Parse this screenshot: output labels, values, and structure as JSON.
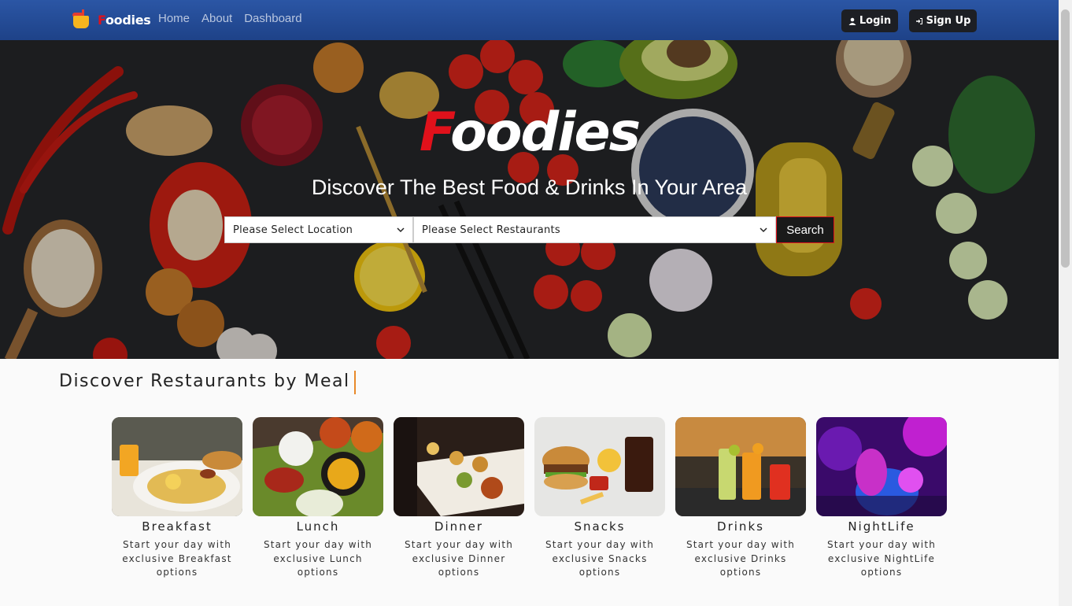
{
  "navbar": {
    "brand_first": "F",
    "brand_rest": "oodies",
    "links": [
      "Home",
      "About",
      "Dashboard"
    ],
    "login_label": "Login",
    "signup_label": "Sign Up"
  },
  "hero": {
    "title_first": "F",
    "title_rest": "oodies",
    "subtitle": "Discover The Best Food & Drinks In Your Area",
    "location_placeholder": "Please Select Location",
    "restaurant_placeholder": "Please Select Restaurants",
    "search_label": "Search"
  },
  "meals_section": {
    "title": "Discover Restaurants by Meal",
    "cards": [
      {
        "name": "Breakfast",
        "desc_line1": "Start your day with",
        "desc_line2": "exclusive Breakfast",
        "desc_line3": "options"
      },
      {
        "name": "Lunch",
        "desc_line1": "Start your day with",
        "desc_line2": "exclusive Lunch",
        "desc_line3": "options"
      },
      {
        "name": "Dinner",
        "desc_line1": "Start your day with",
        "desc_line2": "exclusive Dinner",
        "desc_line3": "options"
      },
      {
        "name": "Snacks",
        "desc_line1": "Start your day with",
        "desc_line2": "exclusive Snacks",
        "desc_line3": "options"
      },
      {
        "name": "Drinks",
        "desc_line1": "Start your day with",
        "desc_line2": "exclusive Drinks",
        "desc_line3": "options"
      },
      {
        "name": "NightLife",
        "desc_line1": "Start your day with",
        "desc_line2": "exclusive NightLife",
        "desc_line3": "options"
      }
    ]
  },
  "colors": {
    "navbar": "#2b56a5",
    "brand_red": "#e0111b",
    "accent_orange": "#e8892a"
  }
}
